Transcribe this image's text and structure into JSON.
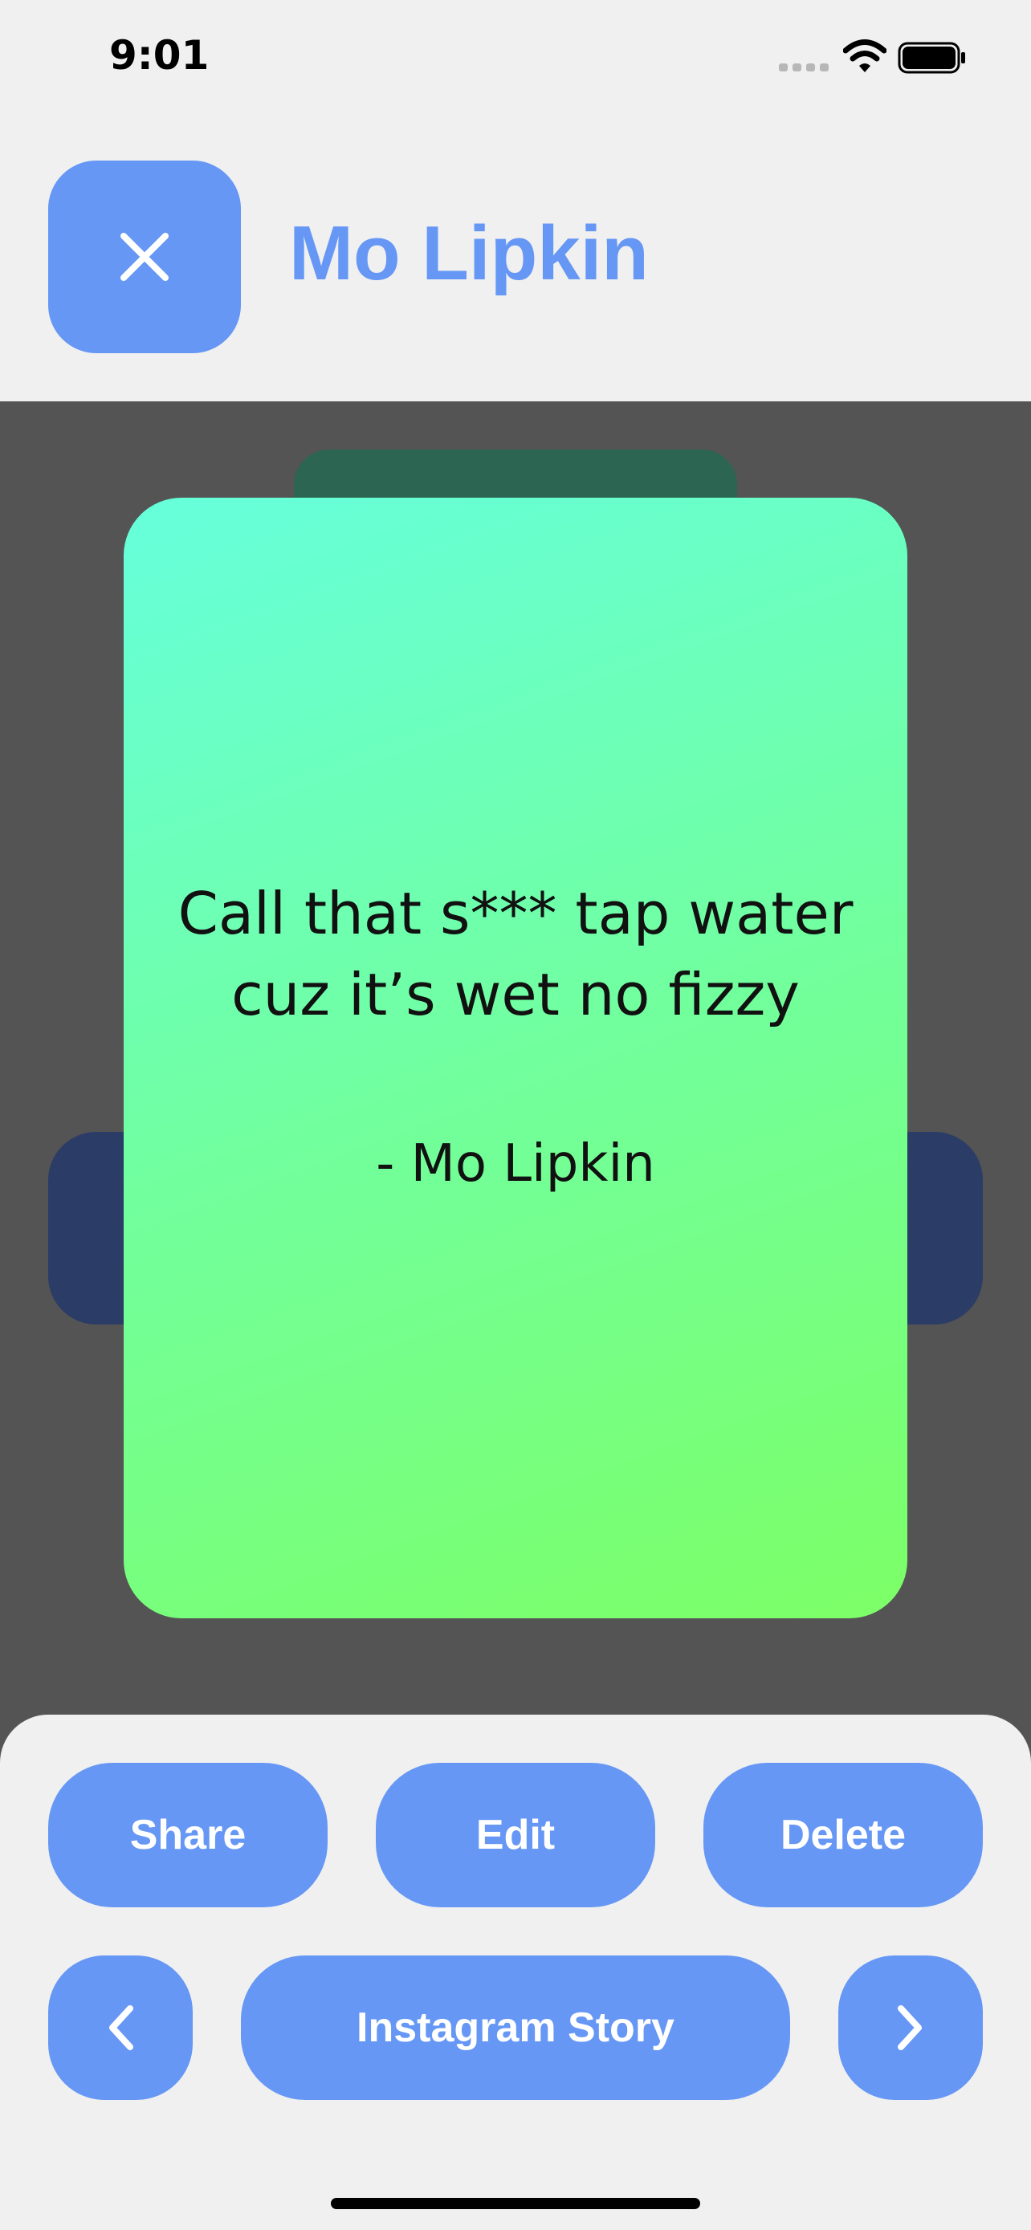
{
  "status_bar": {
    "time": "9:01",
    "icons": [
      "signal-icon",
      "wifi-icon",
      "battery-icon"
    ]
  },
  "header": {
    "close_icon": "close-icon",
    "title": "Mo Lipkin"
  },
  "card": {
    "quote_line1": "Call that s*** tap water",
    "quote_line2": "cuz it’s wet no fizzy",
    "author": "- Mo Lipkin"
  },
  "actions": {
    "share_label": "Share",
    "edit_label": "Edit",
    "delete_label": "Delete",
    "story_label": "Instagram Story",
    "prev_icon": "chevron-left-icon",
    "next_icon": "chevron-right-icon"
  },
  "colors": {
    "accent": "#6697f5",
    "stage_background": "#545454",
    "card_gradient_start": "#66ffdc",
    "card_gradient_end": "#7cff66",
    "back_card_navy": "#2b3c66",
    "back_card_green": "#2c6552"
  }
}
